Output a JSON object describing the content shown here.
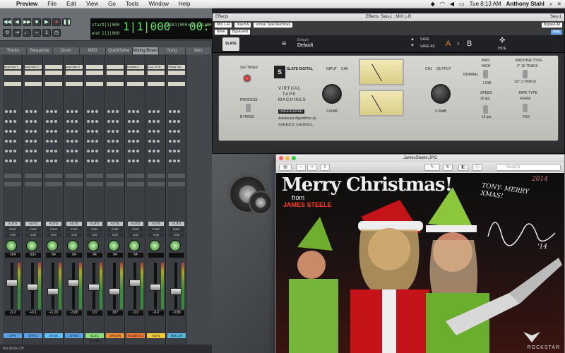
{
  "menubar": {
    "app": "Preview",
    "items": [
      "File",
      "Edit",
      "View",
      "Go",
      "Tools",
      "Window",
      "Help"
    ],
    "clock": "Tue 8:13 AM",
    "user": "Anthony Stahl"
  },
  "transport": {
    "main_counter": "1|1|000",
    "sub_counter": "00:",
    "start_label": "start",
    "start_value": "1|1|000",
    "end_label": "end",
    "end_value": "1|1|000",
    "length_label": "length",
    "length_value": "0|0|000",
    "in_label": "in",
    "in_value": "181|000",
    "out_label": "out",
    "out_value": "211|000"
  },
  "tabs": [
    "Tracks",
    "Sequence",
    "Drum",
    "MIDI",
    "QuickSolve",
    "Mixing Board",
    "Song",
    "Vers"
  ],
  "tracks": [
    {
      "name": "DTR",
      "vol": "-0.2",
      "pan": "<64",
      "color": "#5aa0e0",
      "insert": "ampTube 2"
    },
    {
      "name": "DTR 2",
      "vol": "+0.1",
      "pan": "63>",
      "color": "#5aa0e0",
      "insert": "ampTube 2"
    },
    {
      "name": "BASS",
      "vol": "+1.20",
      "pan": "64",
      "color": "#62c0ff",
      "insert": ""
    },
    {
      "name": "DTR3",
      "vol": "-3.80",
      "pan": "64",
      "color": "#5aa0e0",
      "insert": "ampTube 2"
    },
    {
      "name": "ELEC PIANO",
      "vol": "107",
      "pan": "64",
      "color": "#8ce07c",
      "insert": ""
    },
    {
      "name": "ORGAN",
      "vol": "107",
      "pan": "64",
      "color": "#f0923c",
      "insert": ""
    },
    {
      "name": "Kontakt 5 1",
      "vol": "-0.0",
      "pan": "64",
      "color": "#f47a3a",
      "insert": "Kontakt 5"
    },
    {
      "name": "Aux-1",
      "vol": "-0.0",
      "pan": "",
      "color": "#f0c83c",
      "insert": "CLA-76 St"
    },
    {
      "name": "MIX L-R",
      "vol": "-3.88",
      "pan": "",
      "color": "#59b6e0",
      "insert": "Virtual Tap"
    }
  ],
  "auto_label": "AUTO",
  "mute_label": "mute",
  "solo_label": "solo",
  "bottombar": "Mix Mode Off",
  "effects": {
    "title": "Effects: Seq-1 : MIX L-R",
    "left_tab": "Effects",
    "seq": "Seq-1",
    "track_select": "MIX L-R",
    "insert_select": "Insert A",
    "plugin_name": "Virtual Tape Machines",
    "none_label": "None",
    "bypass_label": "Bypassed",
    "bypass_all": "Bypass All",
    "auto": "Auto",
    "preset_header": "Default",
    "preset": "Default",
    "save": "SAVE",
    "save_as": "SAVE AS",
    "ab_a": "A",
    "ab_b": "B",
    "hide": "HIDE",
    "logo": "SLATE DIGITAL",
    "product_lines": [
      "VIRTUAL",
      "TAPE",
      "MACHINES"
    ],
    "grouped": "UNGROUPED",
    "credit": "Advanced Algorithms by",
    "author": "FABRICE GABRIEL",
    "settings": "SETTINGS",
    "process": "PROCESS",
    "bypass": "BYPASS",
    "input": "INPUT",
    "output": "OUTPUT",
    "input_value": "0.00dB",
    "output_value": "0.00dB",
    "ch0": "CH0",
    "ch1": "CH1",
    "bias": "BIAS",
    "high": "HIGH",
    "normal": "NORMAL",
    "low": "LOW",
    "speed": "SPEED",
    "speed_hi": "30 ips",
    "speed_lo": "15 ips",
    "machine_type": "MACHINE TYPE",
    "machine_2in": "2\" 16 TRACK",
    "machine_half": "1/2\" 2 TRACK",
    "tape_type": "TAPE TYPE",
    "tape_a": "FG456",
    "tape_b": "FG9"
  },
  "preview": {
    "filename": "JamesSteele.JPG",
    "search_placeholder": "Search",
    "headline": "Merry Christmas!",
    "from": "from",
    "artist": "JAMES STEELE",
    "handwriting": "TONY- MERRY XMAS!",
    "signature_year": "'14",
    "year_tag": "2014",
    "brand": "ROCKSTAR"
  }
}
